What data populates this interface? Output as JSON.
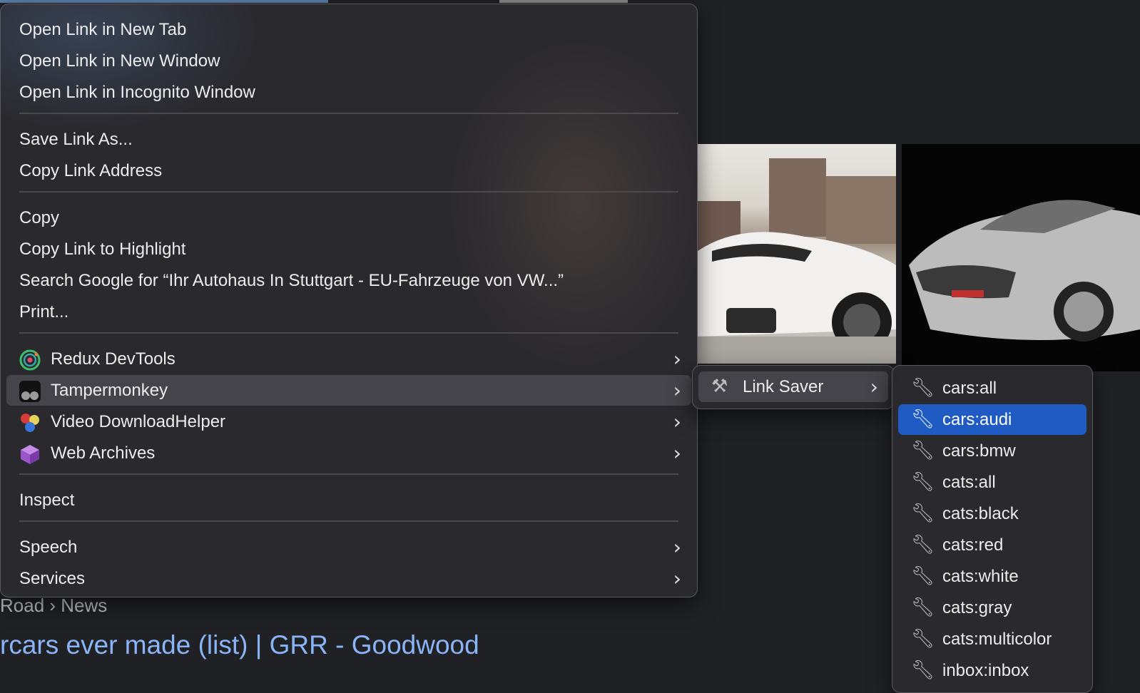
{
  "background": {
    "search_meta": "Road › News",
    "search_title": "rcars ever made (list) | GRR - Goodwood"
  },
  "context_menu": {
    "groups": [
      {
        "items": [
          {
            "label": "Open Link in New Tab"
          },
          {
            "label": "Open Link in New Window"
          },
          {
            "label": "Open Link in Incognito Window"
          }
        ]
      },
      {
        "items": [
          {
            "label": "Save Link As..."
          },
          {
            "label": "Copy Link Address"
          }
        ]
      },
      {
        "items": [
          {
            "label": "Copy"
          },
          {
            "label": "Copy Link to Highlight"
          },
          {
            "label": "Search Google for “Ihr Autohaus In Stuttgart - EU-Fahrzeuge von VW...”"
          },
          {
            "label": "Print..."
          }
        ]
      },
      {
        "items": [
          {
            "label": "Redux DevTools",
            "icon": "redux-devtools-icon",
            "submenu": true
          },
          {
            "label": "Tampermonkey",
            "icon": "tampermonkey-icon",
            "submenu": true,
            "active": true
          },
          {
            "label": "Video DownloadHelper",
            "icon": "video-downloadhelper-icon",
            "submenu": true
          },
          {
            "label": "Web Archives",
            "icon": "web-archives-icon",
            "submenu": true
          }
        ]
      },
      {
        "items": [
          {
            "label": "Inspect"
          }
        ]
      },
      {
        "items": [
          {
            "label": "Speech",
            "submenu": true
          },
          {
            "label": "Services",
            "submenu": true
          }
        ]
      }
    ]
  },
  "tampermonkey_submenu": {
    "items": [
      {
        "label": "Link Saver",
        "icon": "tools-icon",
        "submenu": true,
        "active": true
      }
    ]
  },
  "link_saver_submenu": {
    "selected": "cars:audi",
    "items": [
      {
        "label": "cars:all"
      },
      {
        "label": "cars:audi"
      },
      {
        "label": "cars:bmw"
      },
      {
        "label": "cats:all"
      },
      {
        "label": "cats:black"
      },
      {
        "label": "cats:red"
      },
      {
        "label": "cats:white"
      },
      {
        "label": "cats:gray"
      },
      {
        "label": "cats:multicolor"
      },
      {
        "label": "inbox:inbox"
      }
    ]
  },
  "colors": {
    "selection": "#1f5bc2",
    "link": "#8ab4f8",
    "menu_bg": "#2a292e"
  }
}
